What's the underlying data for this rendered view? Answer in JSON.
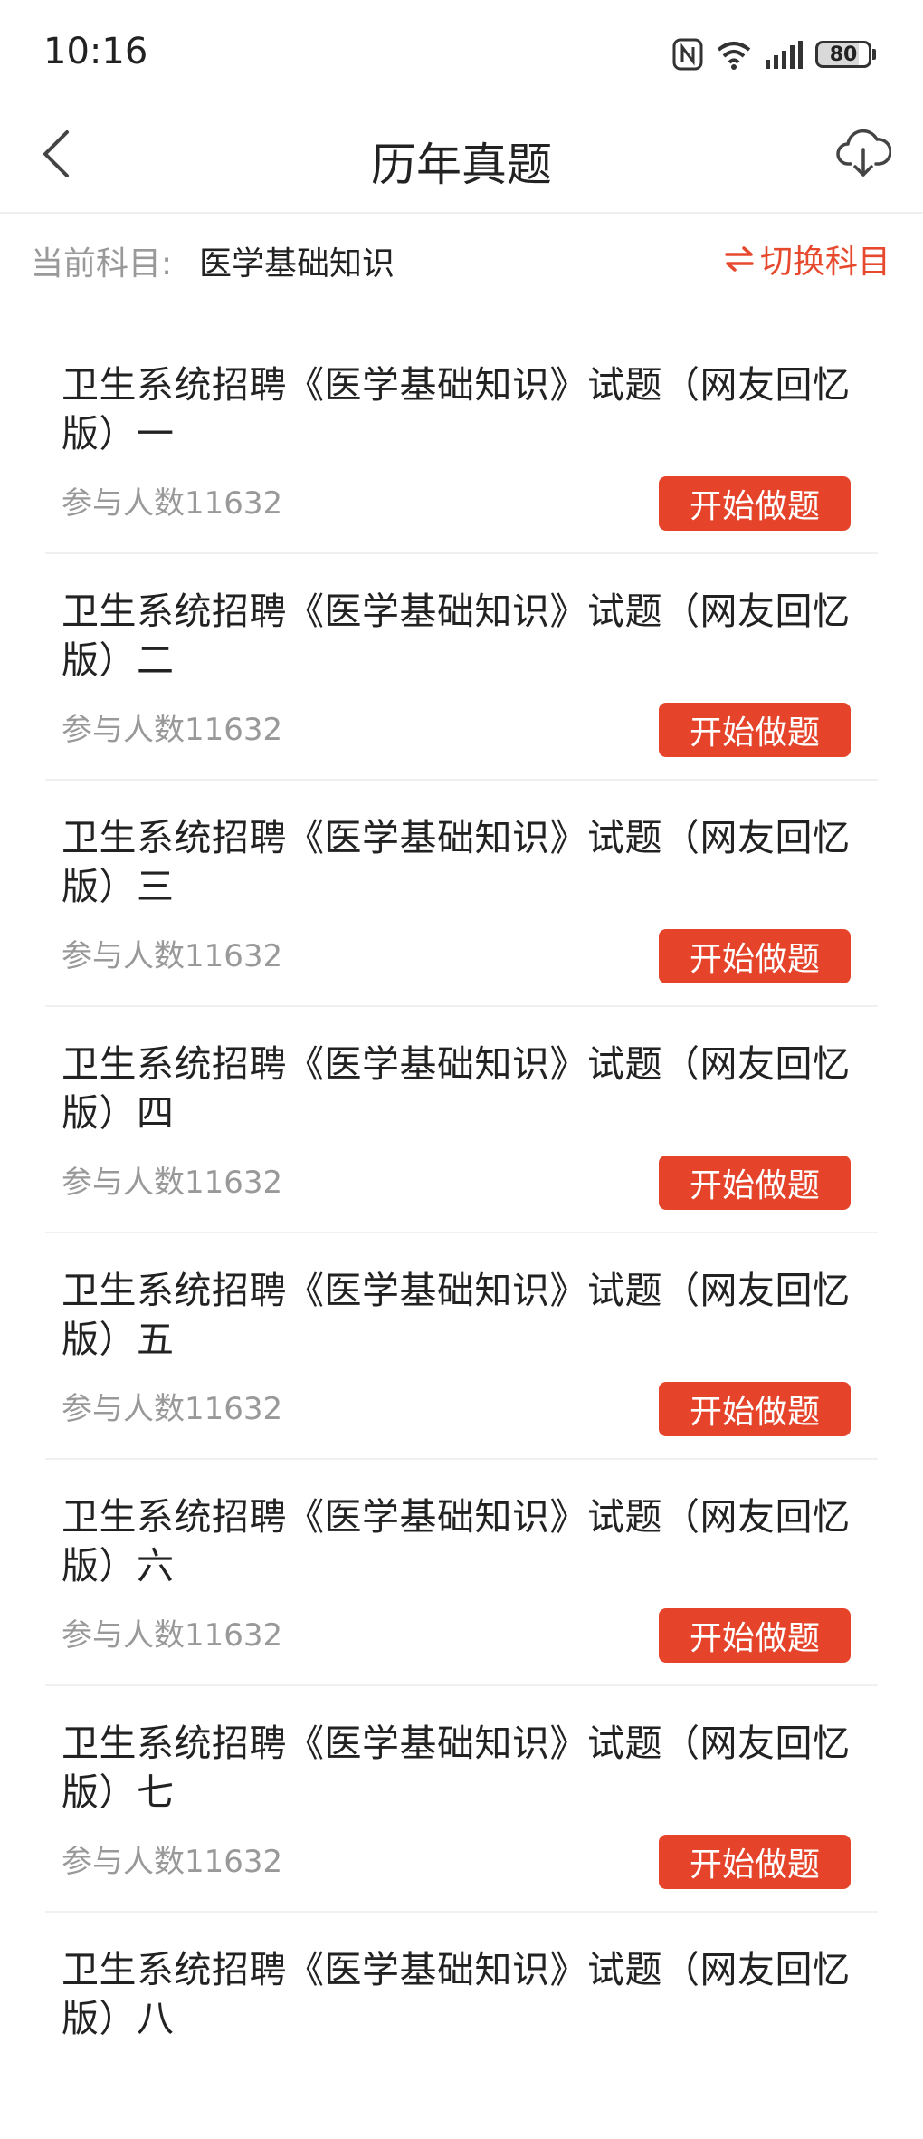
{
  "status_bar": {
    "time": "10:16",
    "battery": "80",
    "battery_level": 0.8,
    "icons": [
      "nfc-icon",
      "wifi-icon",
      "signal-icon",
      "battery-icon"
    ]
  },
  "nav": {
    "title": "历年真题",
    "back_icon": "chevron-left-icon",
    "download_icon": "cloud-download-icon"
  },
  "subject": {
    "label": "当前科目:",
    "value": "医学基础知识",
    "switch_label": "切换科目",
    "switch_icon": "swap-arrows-icon"
  },
  "colors": {
    "accent": "#e6432b",
    "muted_text": "#999999",
    "text": "#222222"
  },
  "exams": [
    {
      "title": "卫生系统招聘《医学基础知识》试题（网友回忆版）一",
      "participants": "参与人数11632",
      "button": "开始做题"
    },
    {
      "title": "卫生系统招聘《医学基础知识》试题（网友回忆版）二",
      "participants": "参与人数11632",
      "button": "开始做题"
    },
    {
      "title": "卫生系统招聘《医学基础知识》试题（网友回忆版）三",
      "participants": "参与人数11632",
      "button": "开始做题"
    },
    {
      "title": "卫生系统招聘《医学基础知识》试题（网友回忆版）四",
      "participants": "参与人数11632",
      "button": "开始做题"
    },
    {
      "title": "卫生系统招聘《医学基础知识》试题（网友回忆版）五",
      "participants": "参与人数11632",
      "button": "开始做题"
    },
    {
      "title": "卫生系统招聘《医学基础知识》试题（网友回忆版）六",
      "participants": "参与人数11632",
      "button": "开始做题"
    },
    {
      "title": "卫生系统招聘《医学基础知识》试题（网友回忆版）七",
      "participants": "参与人数11632",
      "button": "开始做题"
    },
    {
      "title": "卫生系统招聘《医学基础知识》试题（网友回忆版）八",
      "participants": "",
      "button": ""
    }
  ]
}
